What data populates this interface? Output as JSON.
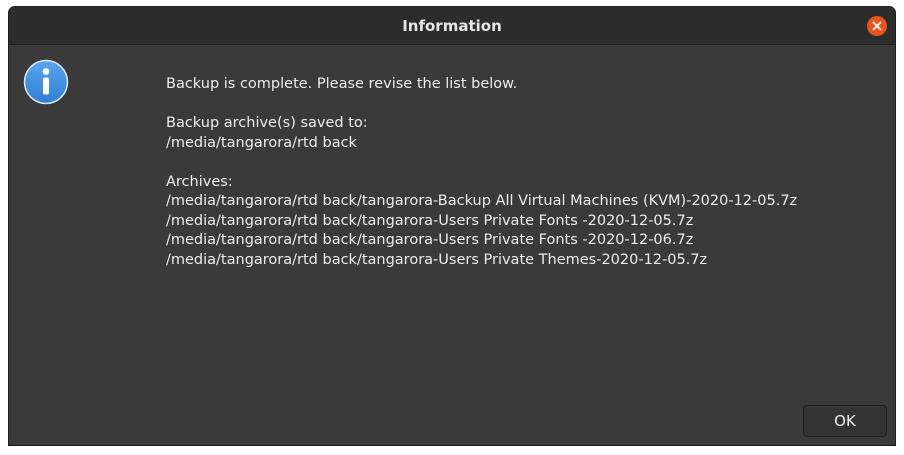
{
  "window": {
    "title": "Information"
  },
  "icons": {
    "dialog": "info-icon",
    "close": "close-icon"
  },
  "colors": {
    "close_button": "#e9541f",
    "info_icon": "#3d8ee3",
    "background": "#3a3a3a"
  },
  "message": {
    "intro": "Backup is complete. Please revise the list below.",
    "saved_to_label": "Backup archive(s) saved to:",
    "saved_to_path": "/media/tangarora/rtd back",
    "archives_label": "Archives:",
    "archives": [
      "/media/tangarora/rtd back/tangarora-Backup All Virtual Machines (KVM)-2020-12-05.7z",
      "/media/tangarora/rtd back/tangarora-Users Private Fonts -2020-12-05.7z",
      "/media/tangarora/rtd back/tangarora-Users Private Fonts -2020-12-06.7z",
      "/media/tangarora/rtd back/tangarora-Users Private Themes-2020-12-05.7z"
    ]
  },
  "buttons": {
    "ok": "OK"
  }
}
